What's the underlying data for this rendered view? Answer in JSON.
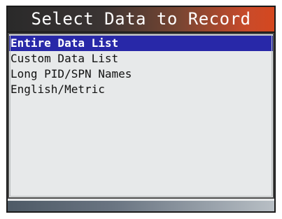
{
  "title": "Select Data to Record",
  "menu": {
    "items": [
      {
        "label": "Entire Data List",
        "selected": true
      },
      {
        "label": "Custom Data List",
        "selected": false
      },
      {
        "label": "Long PID/SPN Names",
        "selected": false
      },
      {
        "label": "English/Metric",
        "selected": false
      }
    ]
  },
  "colors": {
    "selection": "#2828a8",
    "title_accent": "#d4481f",
    "list_background": "#e7e9ea"
  }
}
